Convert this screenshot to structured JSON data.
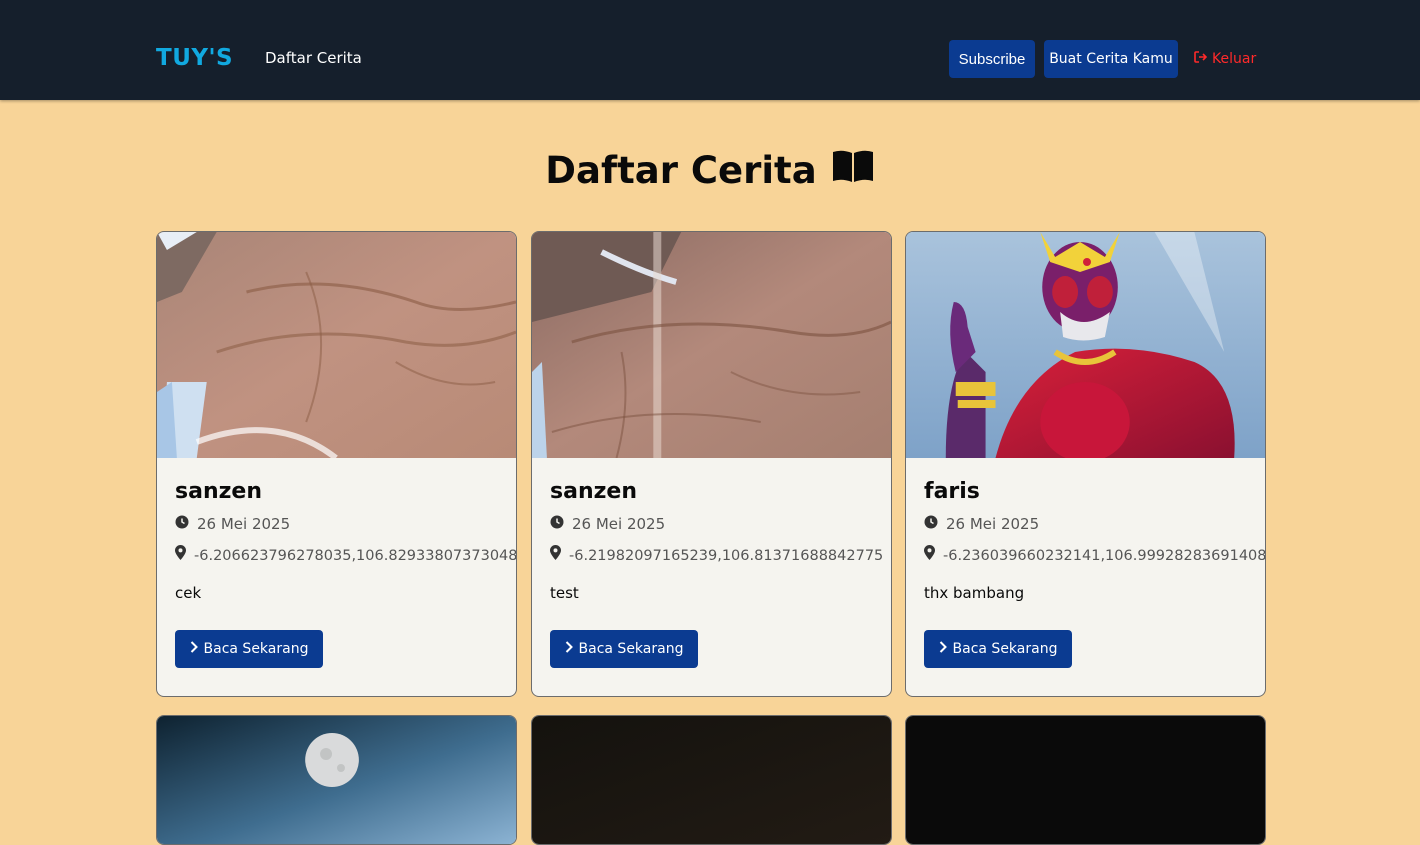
{
  "nav": {
    "brand": "TUY'S",
    "link": "Daftar Cerita",
    "subscribe_label": "Subscribe",
    "create_label": "Buat Cerita Kamu",
    "logout_label": "Keluar"
  },
  "page": {
    "title": "Daftar Cerita"
  },
  "stories": [
    {
      "name": "sanzen",
      "date": "26 Mei 2025",
      "location": "-6.206623796278035,106.82933807373048",
      "description": "cek",
      "button_label": "Baca Sekarang",
      "image": "hand-photo"
    },
    {
      "name": "sanzen",
      "date": "26 Mei 2025",
      "location": "-6.21982097165239,106.81371688842775",
      "description": "test",
      "button_label": "Baca Sekarang",
      "image": "hand-photo"
    },
    {
      "name": "faris",
      "date": "26 Mei 2025",
      "location": "-6.236039660232141,106.99928283691408",
      "description": "thx bambang",
      "button_label": "Baca Sekarang",
      "image": "kamen-rider-photo"
    }
  ],
  "partial_cards": [
    {
      "image": "moon-sky-photo"
    },
    {
      "image": "dark-photo"
    },
    {
      "image": "black-photo"
    }
  ],
  "colors": {
    "background": "#f8d498",
    "navbar": "#151f2c",
    "brand": "#11a9e0",
    "primary_button": "#0b3b91",
    "logout": "#ff2a2a",
    "card": "#f5f4ef"
  },
  "icons": {
    "date": "clock-icon",
    "location": "map-pin-icon",
    "read": "chevron-right-icon",
    "logout": "logout-icon",
    "title": "open-book-icon"
  }
}
